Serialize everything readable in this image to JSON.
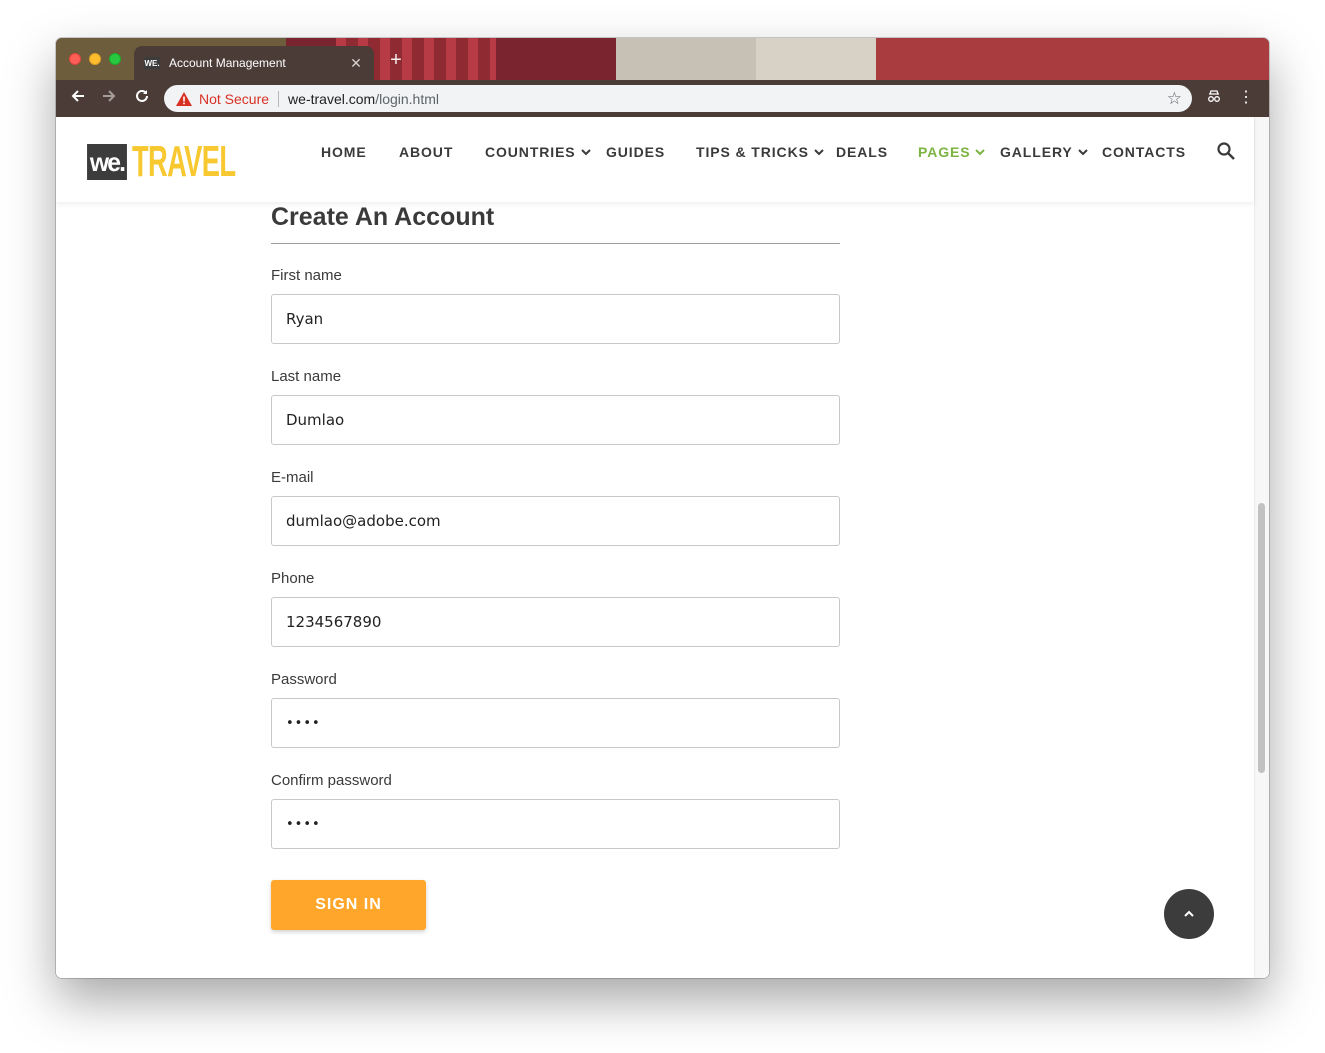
{
  "browser": {
    "tab_title": "Account Management",
    "tab_favicon_text": "WE.",
    "security_label": "Not Secure",
    "url_host": "we-travel.com",
    "url_path": "/login.html",
    "icons": [
      "back-icon",
      "forward-icon",
      "reload-icon",
      "warning-icon",
      "star-icon",
      "extension-icon",
      "menu-icon",
      "close-icon",
      "new-tab-icon"
    ]
  },
  "site": {
    "logo_we": "we.",
    "logo_travel": "TRAVEL",
    "nav": [
      {
        "label": "HOME",
        "dropdown": false,
        "active": false
      },
      {
        "label": "ABOUT",
        "dropdown": false,
        "active": false
      },
      {
        "label": "COUNTRIES",
        "dropdown": true,
        "active": false
      },
      {
        "label": "GUIDES",
        "dropdown": false,
        "active": false
      },
      {
        "label": "TIPS & TRICKS",
        "dropdown": true,
        "active": false
      },
      {
        "label": "DEALS",
        "dropdown": false,
        "active": false
      },
      {
        "label": "PAGES",
        "dropdown": true,
        "active": true
      },
      {
        "label": "GALLERY",
        "dropdown": true,
        "active": false
      },
      {
        "label": "CONTACTS",
        "dropdown": false,
        "active": false
      }
    ],
    "colors": {
      "accent_green": "#7cb342",
      "logo_yellow": "#f7c830",
      "button_orange": "#ffa62b",
      "text_dark": "#3a3a3a"
    }
  },
  "form": {
    "title": "Create An Account",
    "fields": [
      {
        "label": "First name",
        "value": "Ryan"
      },
      {
        "label": "Last name",
        "value": "Dumlao"
      },
      {
        "label": "E-mail",
        "value": "dumlao@adobe.com"
      },
      {
        "label": "Phone",
        "value": "1234567890"
      },
      {
        "label": "Password",
        "value": "••••"
      },
      {
        "label": "Confirm password",
        "value": "••••"
      }
    ],
    "submit_label": "SIGN IN"
  }
}
